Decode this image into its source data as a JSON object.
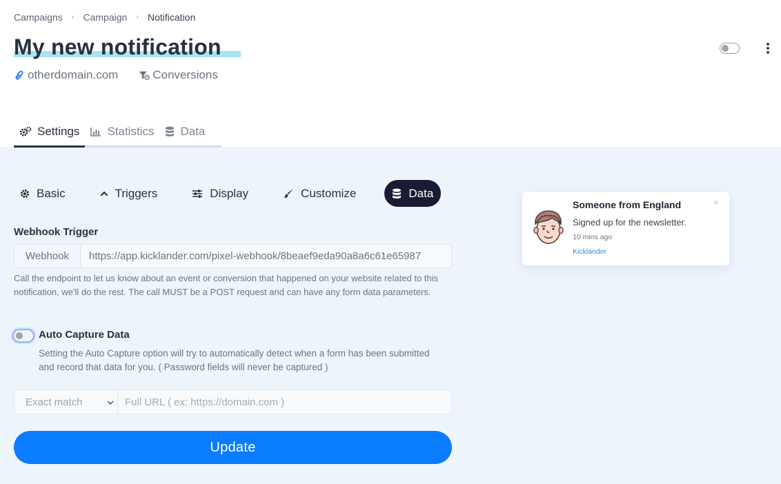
{
  "breadcrumb": {
    "items": [
      "Campaigns",
      "Campaign",
      "Notification"
    ],
    "separator": "›"
  },
  "header": {
    "title": "My new notification",
    "domain": "otherdomain.com",
    "type": "Conversions",
    "enabled": false
  },
  "main_tabs": [
    {
      "label": "Settings",
      "icon": "gears-icon",
      "active": true
    },
    {
      "label": "Statistics",
      "icon": "bar-chart-icon",
      "active": false
    },
    {
      "label": "Data",
      "icon": "database-icon",
      "active": false
    }
  ],
  "sub_tabs": [
    {
      "label": "Basic",
      "icon": "gear-icon",
      "active": false
    },
    {
      "label": "Triggers",
      "icon": "chevron-up-icon",
      "active": false
    },
    {
      "label": "Display",
      "icon": "sliders-icon",
      "active": false
    },
    {
      "label": "Customize",
      "icon": "paintbrush-icon",
      "active": false
    },
    {
      "label": "Data",
      "icon": "database-icon",
      "active": true
    }
  ],
  "webhook": {
    "label": "Webhook Trigger",
    "addon": "Webhook",
    "value": "https://app.kicklander.com/pixel-webhook/8beaef9eda90a8a6c61e65987",
    "help": "Call the endpoint to let us know about an event or conversion that happened on your website related to this notification, we'll do the rest. The call MUST be a POST request and can have any form data parameters."
  },
  "auto_capture": {
    "label": "Auto Capture Data",
    "enabled": false,
    "help": "Setting the Auto Capture option will try to automatically detect when a form has been submitted and record that data for you. ( Password fields will never be captured )"
  },
  "url_filter": {
    "match_selected": "Exact match",
    "placeholder": "Full URL ( ex: https://domain.com )"
  },
  "update_button": "Update",
  "preview": {
    "title": "Someone from England",
    "body": "Signed up for the newsletter.",
    "time": "10 mins ago",
    "brand": "Kicklander",
    "close": "×"
  },
  "colors": {
    "primary": "#0a7cff",
    "active_pill": "#1a1c33",
    "page_bg": "#eef4fc",
    "title_highlight": "#a7e3f0",
    "link": "#2f86d8"
  }
}
